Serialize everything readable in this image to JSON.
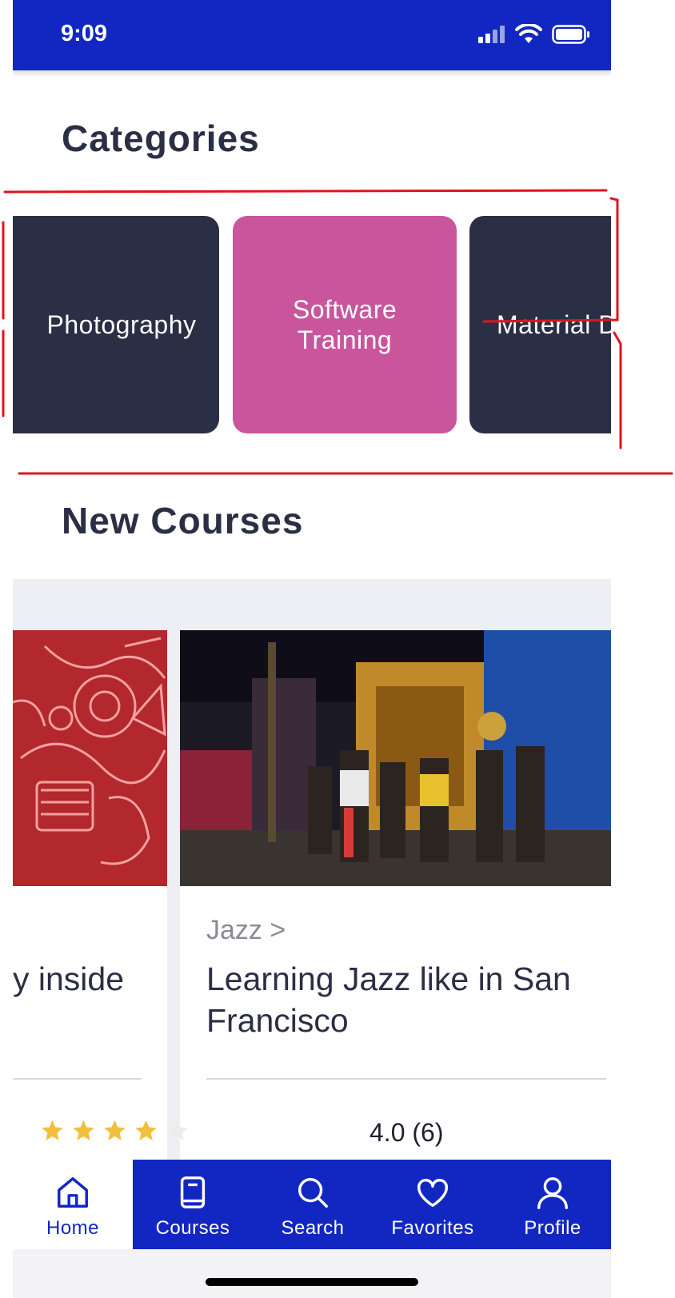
{
  "status": {
    "time": "9:09"
  },
  "categories": {
    "title": "Categories",
    "items": [
      {
        "label": "Photography"
      },
      {
        "label": "Software Training"
      },
      {
        "label": "Material Des"
      }
    ]
  },
  "new_courses": {
    "title": "New Courses",
    "courses": [
      {
        "title_fragment": "y inside"
      },
      {
        "category": "Jazz >",
        "title": "Learning Jazz like in San Francisco",
        "rating": "4.0 (6)",
        "stars_filled": 4,
        "stars_total": 5
      }
    ]
  },
  "tabbar": {
    "items": [
      {
        "label": "Home",
        "icon": "home-icon"
      },
      {
        "label": "Courses",
        "icon": "book-icon"
      },
      {
        "label": "Search",
        "icon": "search-icon"
      },
      {
        "label": "Favorites",
        "icon": "heart-icon"
      },
      {
        "label": "Profile",
        "icon": "profile-icon"
      }
    ]
  },
  "colors": {
    "primary": "#1227c2",
    "dark_card": "#2b2f45",
    "pink_card": "#c9569d",
    "star": "#f2c03c"
  }
}
